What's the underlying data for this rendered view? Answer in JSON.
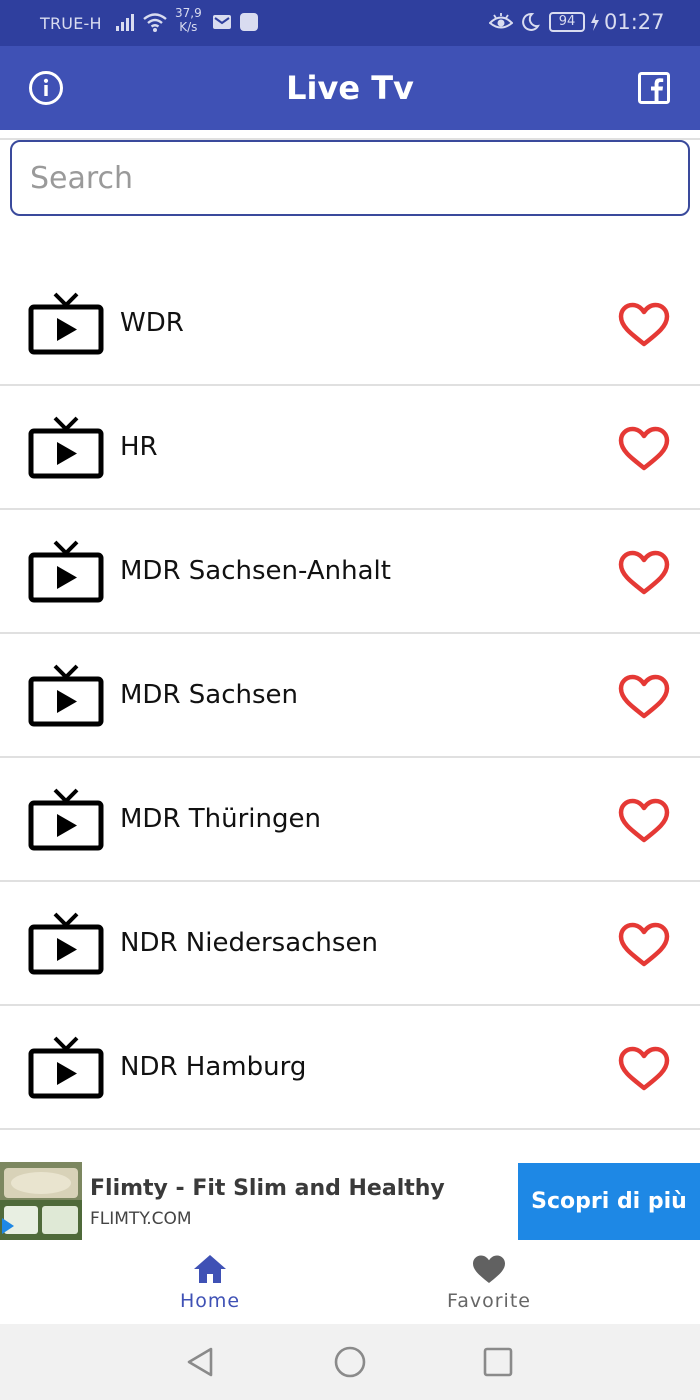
{
  "status_bar": {
    "carrier": "TRUE-H",
    "speed_value": "37,9",
    "speed_unit": "K/s",
    "battery": "94",
    "time": "01:27"
  },
  "app_bar": {
    "title": "Live Tv",
    "left_icon": "info-icon",
    "right_icon": "facebook-icon"
  },
  "search": {
    "placeholder": "Search",
    "value": ""
  },
  "channels": [
    {
      "name": "",
      "favorite": false
    },
    {
      "name": "WDR",
      "favorite": false
    },
    {
      "name": "HR",
      "favorite": false
    },
    {
      "name": "MDR Sachsen-Anhalt",
      "favorite": false
    },
    {
      "name": "MDR Sachsen",
      "favorite": false
    },
    {
      "name": "MDR Thüringen",
      "favorite": false
    },
    {
      "name": "NDR Niedersachsen",
      "favorite": false
    },
    {
      "name": "NDR Hamburg",
      "favorite": false
    }
  ],
  "ad": {
    "title": "Flimty - Fit Slim and Healthy",
    "domain": "FLIMTY.COM",
    "cta": "Scopri di più",
    "thumb_brand": "flimty"
  },
  "bottom_nav": {
    "home_label": "Home",
    "favorite_label": "Favorite",
    "active": "home"
  },
  "colors": {
    "status_bar": "#2f3f9e",
    "primary": "#3f51b5",
    "heart": "#e53935",
    "ad_cta": "#1e88e5"
  }
}
